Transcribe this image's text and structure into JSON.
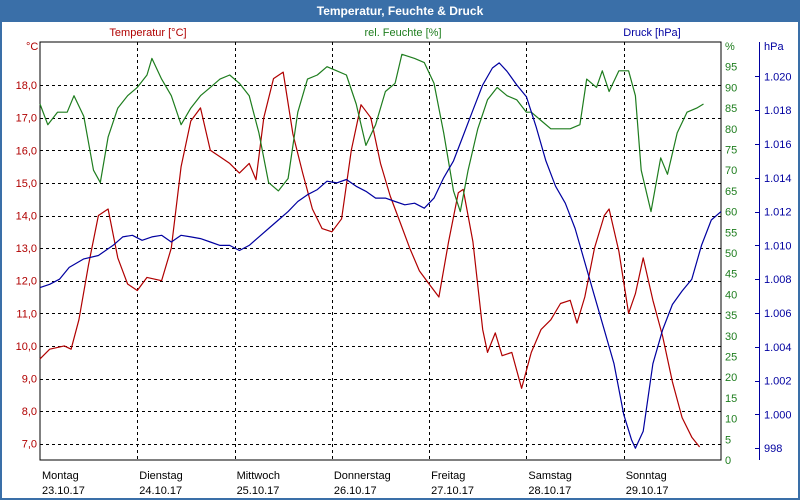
{
  "window": {
    "title": "Temperatur, Feuchte & Druck"
  },
  "chart_data": {
    "type": "line",
    "title": "Temperatur, Feuchte & Druck",
    "grid": true,
    "colors": {
      "temperature": "#b00000",
      "humidity": "#1e7d1e",
      "pressure": "#0000a0",
      "title_bar": "#3a6fa8"
    },
    "axes": {
      "temperature": {
        "label": "Temperatur [°C]",
        "unit": "°C",
        "range": [
          6.5,
          19.2
        ],
        "ticks": [
          "7,0",
          "8,0",
          "9,0",
          "10,0",
          "11,0",
          "12,0",
          "13,0",
          "14,0",
          "15,0",
          "16,0",
          "17,0",
          "18,0"
        ]
      },
      "humidity": {
        "label": "rel. Feuchte [%]",
        "unit": "%",
        "range": [
          0,
          100
        ],
        "ticks": [
          "0",
          "5",
          "10",
          "15",
          "20",
          "25",
          "30",
          "35",
          "40",
          "45",
          "50",
          "55",
          "60",
          "65",
          "70",
          "75",
          "80",
          "85",
          "90",
          "95",
          "%"
        ]
      },
      "pressure": {
        "label": "Druck [hPa]",
        "unit": "hPa",
        "range": [
          997.3,
          1021.8
        ],
        "ticks": [
          "998",
          "1.000",
          "1.002",
          "1.004",
          "1.006",
          "1.008",
          "1.010",
          "1.012",
          "1.014",
          "1.016",
          "1.018",
          "1.020"
        ]
      }
    },
    "x_categories": [
      {
        "day": "Montag",
        "date": "23.10.17"
      },
      {
        "day": "Dienstag",
        "date": "24.10.17"
      },
      {
        "day": "Mittwoch",
        "date": "25.10.17"
      },
      {
        "day": "Donnerstag",
        "date": "26.10.17"
      },
      {
        "day": "Freitag",
        "date": "27.10.17"
      },
      {
        "day": "Samstag",
        "date": "28.10.17"
      },
      {
        "day": "Sonntag",
        "date": "29.10.17"
      }
    ],
    "x_range_days": [
      0,
      7
    ],
    "series": [
      {
        "name": "Temperatur [°C]",
        "axis": "temperature",
        "points": [
          [
            0,
            9.6
          ],
          [
            0.1,
            9.9
          ],
          [
            0.25,
            10.0
          ],
          [
            0.32,
            9.9
          ],
          [
            0.4,
            10.8
          ],
          [
            0.5,
            12.5
          ],
          [
            0.6,
            14.0
          ],
          [
            0.7,
            14.2
          ],
          [
            0.8,
            12.7
          ],
          [
            0.9,
            11.9
          ],
          [
            1.0,
            11.7
          ],
          [
            1.1,
            12.1
          ],
          [
            1.25,
            12.0
          ],
          [
            1.35,
            13.0
          ],
          [
            1.45,
            15.5
          ],
          [
            1.55,
            16.9
          ],
          [
            1.65,
            17.3
          ],
          [
            1.75,
            16.0
          ],
          [
            1.85,
            15.8
          ],
          [
            1.95,
            15.6
          ],
          [
            2.05,
            15.3
          ],
          [
            2.15,
            15.6
          ],
          [
            2.22,
            15.1
          ],
          [
            2.3,
            17.0
          ],
          [
            2.4,
            18.2
          ],
          [
            2.5,
            18.4
          ],
          [
            2.6,
            16.5
          ],
          [
            2.7,
            15.3
          ],
          [
            2.8,
            14.2
          ],
          [
            2.9,
            13.6
          ],
          [
            3.0,
            13.5
          ],
          [
            3.1,
            13.9
          ],
          [
            3.2,
            16.0
          ],
          [
            3.3,
            17.4
          ],
          [
            3.4,
            17.0
          ],
          [
            3.5,
            15.6
          ],
          [
            3.6,
            14.6
          ],
          [
            3.7,
            13.8
          ],
          [
            3.8,
            13.0
          ],
          [
            3.9,
            12.3
          ],
          [
            4.0,
            11.9
          ],
          [
            4.1,
            11.5
          ],
          [
            4.2,
            13.2
          ],
          [
            4.3,
            14.7
          ],
          [
            4.35,
            14.8
          ],
          [
            4.45,
            13.2
          ],
          [
            4.55,
            10.5
          ],
          [
            4.6,
            9.8
          ],
          [
            4.68,
            10.4
          ],
          [
            4.75,
            9.7
          ],
          [
            4.85,
            9.8
          ],
          [
            4.95,
            8.7
          ],
          [
            5.05,
            9.8
          ],
          [
            5.15,
            10.5
          ],
          [
            5.25,
            10.8
          ],
          [
            5.35,
            11.3
          ],
          [
            5.45,
            11.4
          ],
          [
            5.52,
            10.7
          ],
          [
            5.6,
            11.5
          ],
          [
            5.7,
            13.0
          ],
          [
            5.8,
            14.0
          ],
          [
            5.85,
            14.2
          ],
          [
            5.95,
            12.9
          ],
          [
            6.05,
            11.0
          ],
          [
            6.12,
            11.6
          ],
          [
            6.2,
            12.7
          ],
          [
            6.3,
            11.4
          ],
          [
            6.4,
            10.3
          ],
          [
            6.5,
            8.9
          ],
          [
            6.6,
            7.8
          ],
          [
            6.7,
            7.2
          ],
          [
            6.78,
            6.9
          ]
        ]
      },
      {
        "name": "rel. Feuchte [%]",
        "axis": "humidity",
        "points": [
          [
            0,
            86
          ],
          [
            0.08,
            81
          ],
          [
            0.18,
            84
          ],
          [
            0.28,
            84
          ],
          [
            0.35,
            88
          ],
          [
            0.45,
            83
          ],
          [
            0.55,
            70
          ],
          [
            0.62,
            67
          ],
          [
            0.7,
            78
          ],
          [
            0.8,
            85
          ],
          [
            0.9,
            88
          ],
          [
            1.0,
            90
          ],
          [
            1.1,
            93
          ],
          [
            1.15,
            97
          ],
          [
            1.25,
            92
          ],
          [
            1.35,
            88
          ],
          [
            1.45,
            81
          ],
          [
            1.55,
            85
          ],
          [
            1.65,
            88
          ],
          [
            1.75,
            90
          ],
          [
            1.85,
            92
          ],
          [
            1.95,
            93
          ],
          [
            2.05,
            91
          ],
          [
            2.15,
            88
          ],
          [
            2.25,
            79
          ],
          [
            2.35,
            67
          ],
          [
            2.45,
            65
          ],
          [
            2.55,
            68
          ],
          [
            2.65,
            84
          ],
          [
            2.75,
            92
          ],
          [
            2.85,
            93
          ],
          [
            2.95,
            95
          ],
          [
            3.05,
            94
          ],
          [
            3.15,
            93
          ],
          [
            3.25,
            86
          ],
          [
            3.35,
            76
          ],
          [
            3.45,
            81
          ],
          [
            3.55,
            89
          ],
          [
            3.65,
            91
          ],
          [
            3.72,
            98
          ],
          [
            3.85,
            97
          ],
          [
            3.95,
            96
          ],
          [
            4.05,
            91
          ],
          [
            4.15,
            79
          ],
          [
            4.25,
            65
          ],
          [
            4.32,
            60
          ],
          [
            4.4,
            70
          ],
          [
            4.5,
            80
          ],
          [
            4.6,
            87
          ],
          [
            4.7,
            90
          ],
          [
            4.8,
            88
          ],
          [
            4.9,
            87
          ],
          [
            5.0,
            84
          ],
          [
            5.05,
            84
          ],
          [
            5.15,
            82
          ],
          [
            5.25,
            80
          ],
          [
            5.35,
            80
          ],
          [
            5.45,
            80
          ],
          [
            5.55,
            81
          ],
          [
            5.62,
            92
          ],
          [
            5.72,
            90
          ],
          [
            5.78,
            94
          ],
          [
            5.85,
            89
          ],
          [
            5.95,
            94
          ],
          [
            6.05,
            94
          ],
          [
            6.12,
            88
          ],
          [
            6.18,
            70
          ],
          [
            6.28,
            60
          ],
          [
            6.38,
            73
          ],
          [
            6.45,
            69
          ],
          [
            6.55,
            79
          ],
          [
            6.65,
            84
          ],
          [
            6.75,
            85
          ],
          [
            6.82,
            86
          ]
        ]
      },
      {
        "name": "Druck [hPa]",
        "axis": "pressure",
        "points": [
          [
            0,
            1007.5
          ],
          [
            0.1,
            1007.7
          ],
          [
            0.2,
            1008.0
          ],
          [
            0.3,
            1008.7
          ],
          [
            0.45,
            1009.2
          ],
          [
            0.6,
            1009.4
          ],
          [
            0.75,
            1010.0
          ],
          [
            0.85,
            1010.5
          ],
          [
            0.95,
            1010.6
          ],
          [
            1.05,
            1010.3
          ],
          [
            1.15,
            1010.5
          ],
          [
            1.25,
            1010.6
          ],
          [
            1.35,
            1010.2
          ],
          [
            1.45,
            1010.6
          ],
          [
            1.55,
            1010.5
          ],
          [
            1.65,
            1010.4
          ],
          [
            1.75,
            1010.2
          ],
          [
            1.85,
            1010.0
          ],
          [
            1.95,
            1010.0
          ],
          [
            2.05,
            1009.7
          ],
          [
            2.15,
            1010.0
          ],
          [
            2.25,
            1010.5
          ],
          [
            2.35,
            1011.0
          ],
          [
            2.45,
            1011.5
          ],
          [
            2.55,
            1012.0
          ],
          [
            2.65,
            1012.6
          ],
          [
            2.75,
            1013.0
          ],
          [
            2.85,
            1013.3
          ],
          [
            2.95,
            1013.8
          ],
          [
            3.05,
            1013.7
          ],
          [
            3.15,
            1013.9
          ],
          [
            3.25,
            1013.5
          ],
          [
            3.35,
            1013.2
          ],
          [
            3.45,
            1012.8
          ],
          [
            3.55,
            1012.8
          ],
          [
            3.65,
            1012.6
          ],
          [
            3.75,
            1012.4
          ],
          [
            3.85,
            1012.5
          ],
          [
            3.95,
            1012.2
          ],
          [
            4.05,
            1012.8
          ],
          [
            4.15,
            1014.0
          ],
          [
            4.25,
            1015.0
          ],
          [
            4.35,
            1016.5
          ],
          [
            4.45,
            1018.0
          ],
          [
            4.55,
            1019.5
          ],
          [
            4.65,
            1020.5
          ],
          [
            4.72,
            1020.8
          ],
          [
            4.8,
            1020.3
          ],
          [
            4.9,
            1019.5
          ],
          [
            5.0,
            1018.8
          ],
          [
            5.1,
            1017.0
          ],
          [
            5.2,
            1015.0
          ],
          [
            5.3,
            1013.5
          ],
          [
            5.4,
            1012.5
          ],
          [
            5.5,
            1011.0
          ],
          [
            5.6,
            1009.0
          ],
          [
            5.7,
            1007.0
          ],
          [
            5.8,
            1005.0
          ],
          [
            5.9,
            1003.0
          ],
          [
            6.0,
            1000.0
          ],
          [
            6.08,
            998.5
          ],
          [
            6.12,
            998.0
          ],
          [
            6.2,
            999.0
          ],
          [
            6.3,
            1003.0
          ],
          [
            6.4,
            1005.0
          ],
          [
            6.5,
            1006.5
          ],
          [
            6.6,
            1007.3
          ],
          [
            6.7,
            1008.0
          ],
          [
            6.8,
            1010.0
          ],
          [
            6.9,
            1011.5
          ],
          [
            7.0,
            1012.0
          ]
        ]
      }
    ]
  }
}
